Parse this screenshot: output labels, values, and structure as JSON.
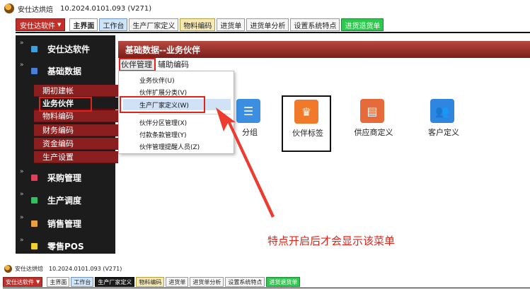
{
  "titlebar": {
    "app_name": "安仕达烘焙",
    "version": "10.2024.0101.093 (V271)"
  },
  "tabbar": {
    "app_menu": "安仕达软件",
    "tabs": [
      "主界面",
      "工作台",
      "生产厂家定义",
      "物料编码",
      "进货单",
      "进货单分析",
      "设置系统特点",
      "进货退货单"
    ]
  },
  "sidebar": {
    "modules": [
      {
        "label": "安仕达软件",
        "icon": "blue-square-icon",
        "color": "#3aa0e0"
      },
      {
        "label": "基础数据",
        "icon": "blue-square-icon",
        "color": "#4a7fd8"
      },
      {
        "label": "采购管理",
        "icon": "red-square-icon",
        "color": "#e0405a"
      },
      {
        "label": "生产调度",
        "icon": "green-square-icon",
        "color": "#30c060"
      },
      {
        "label": "销售管理",
        "icon": "orange-square-icon",
        "color": "#e8a040"
      },
      {
        "label": "零售POS",
        "icon": "yellow-square-icon",
        "color": "#f0d030"
      }
    ],
    "sub_items": [
      "期初建帐",
      "业务伙伴",
      "物料编码",
      "财务编码",
      "资金编码",
      "生产设置"
    ]
  },
  "panel": {
    "header": "基础数据--业务伙伴",
    "menu": [
      "伙伴管理",
      "辅助编码"
    ]
  },
  "dropdown": {
    "items": [
      "业务伙伴(U)",
      "伙伴扩展分类(V)",
      "生产厂家定义(W)",
      "伙伴分区管理(X)",
      "付款条款管理(Y)",
      "伙伴管理提醒人员(Z)"
    ]
  },
  "tiles": [
    {
      "label": "分组",
      "icon": "list-icon",
      "color": "#3b8ee0"
    },
    {
      "label": "伙伴标签",
      "icon": "crown-icon",
      "color": "#f07a2a"
    },
    {
      "label": "供应商定义",
      "icon": "document-icon",
      "color": "#e66a3a"
    },
    {
      "label": "客户定义",
      "icon": "users-icon",
      "color": "#2f86e0"
    }
  ],
  "annotation": "特点开启后才会显示该菜单",
  "bottom": {
    "app_name": "安仕达烘焙",
    "version": "10.2024.0101.093 (V271)",
    "app_menu": "安仕达软件",
    "tabs": [
      "主界面",
      "工作台",
      "生产厂家定义",
      "物料编码",
      "进货单",
      "进货单分析",
      "设置系统特点",
      "进货退货单"
    ]
  }
}
